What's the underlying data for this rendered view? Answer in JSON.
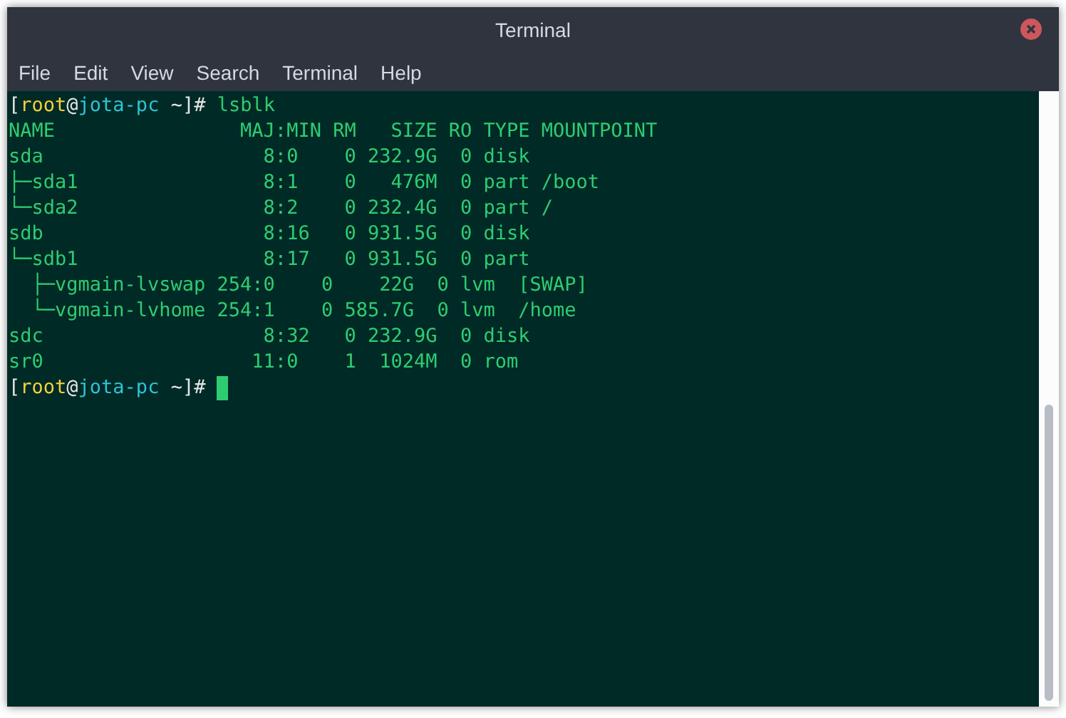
{
  "window": {
    "title": "Terminal"
  },
  "menu": [
    "File",
    "Edit",
    "View",
    "Search",
    "Terminal",
    "Help"
  ],
  "terminal": {
    "lines": [
      {
        "kind": "prompt",
        "parts": [
          {
            "kind": "plain",
            "text": "["
          },
          {
            "kind": "user",
            "text": "root"
          },
          {
            "kind": "plain",
            "text": "@"
          },
          {
            "kind": "host",
            "text": "jota-pc"
          },
          {
            "kind": "plain",
            "text": " ~]# "
          },
          {
            "kind": "output",
            "text": "lsblk"
          }
        ]
      },
      {
        "kind": "output",
        "text": "NAME                MAJ:MIN RM   SIZE RO TYPE MOUNTPOINT"
      },
      {
        "kind": "output",
        "text": "sda                   8:0    0 232.9G  0 disk "
      },
      {
        "kind": "output",
        "text": "├─sda1                8:1    0   476M  0 part /boot"
      },
      {
        "kind": "output",
        "text": "└─sda2                8:2    0 232.4G  0 part /"
      },
      {
        "kind": "output",
        "text": "sdb                   8:16   0 931.5G  0 disk "
      },
      {
        "kind": "output",
        "text": "└─sdb1                8:17   0 931.5G  0 part "
      },
      {
        "kind": "output",
        "text": "  ├─vgmain-lvswap 254:0    0    22G  0 lvm  [SWAP]"
      },
      {
        "kind": "output",
        "text": "  └─vgmain-lvhome 254:1    0 585.7G  0 lvm  /home"
      },
      {
        "kind": "output",
        "text": "sdc                   8:32   0 232.9G  0 disk "
      },
      {
        "kind": "output",
        "text": "sr0                  11:0    1  1024M  0 rom  "
      },
      {
        "kind": "prompt",
        "cursor": true,
        "parts": [
          {
            "kind": "plain",
            "text": "["
          },
          {
            "kind": "user",
            "text": "root"
          },
          {
            "kind": "plain",
            "text": "@"
          },
          {
            "kind": "host",
            "text": "jota-pc"
          },
          {
            "kind": "plain",
            "text": " ~]# "
          }
        ]
      }
    ]
  }
}
